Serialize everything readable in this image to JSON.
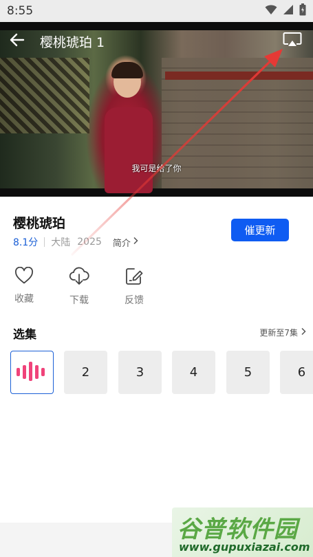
{
  "status_bar": {
    "time": "8:55",
    "icons": [
      "wifi-icon",
      "signal-icon",
      "battery-icon"
    ]
  },
  "player": {
    "title": "樱桃琥珀 1",
    "subtitle": "我可是给了你",
    "back_icon": "arrow-left-icon",
    "cast_icon": "screen-cast-icon"
  },
  "show": {
    "title": "樱桃琥珀",
    "rating": "8.1分",
    "region": "大陆",
    "year": "2025",
    "intro_label": "简介",
    "urge_button": "催更新"
  },
  "actions": [
    {
      "label": "收藏",
      "icon": "heart-icon"
    },
    {
      "label": "下载",
      "icon": "cloud-download-icon"
    },
    {
      "label": "反馈",
      "icon": "feedback-edit-icon"
    }
  ],
  "episodes": {
    "title": "选集",
    "more_label": "更新至7集",
    "items": [
      "",
      "2",
      "3",
      "4",
      "5",
      "6"
    ],
    "playing_icon": "playing-bars-icon"
  },
  "watermark": {
    "brand": "谷普软件园",
    "url": "www.gupuxiazai.com"
  },
  "colors": {
    "accent": "#0f5cf2",
    "rating": "#1a5fd6",
    "playing_bars": "#f0437a",
    "annotation_arrow": "#e53935"
  }
}
